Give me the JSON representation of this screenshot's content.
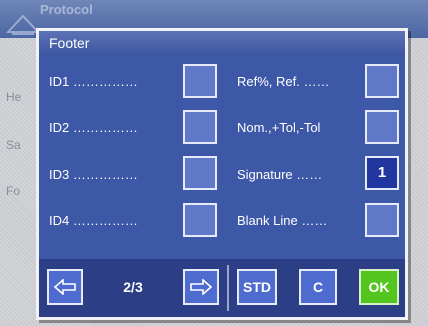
{
  "background": {
    "title": "Protocol",
    "right_fragment": "",
    "items": [
      "He",
      "Sa",
      "Fo"
    ]
  },
  "dialog": {
    "title": "Footer",
    "left_column": [
      {
        "label": "ID1 ……………",
        "checked": false,
        "value": ""
      },
      {
        "label": "ID2 ……………",
        "checked": false,
        "value": ""
      },
      {
        "label": "ID3 ……………",
        "checked": false,
        "value": ""
      },
      {
        "label": "ID4 ……………",
        "checked": false,
        "value": ""
      }
    ],
    "right_column": [
      {
        "label": "Ref%, Ref. ……",
        "checked": false,
        "value": ""
      },
      {
        "label": "Nom.,+Tol,-Tol",
        "checked": false,
        "value": ""
      },
      {
        "label": "Signature ……",
        "checked": true,
        "value": "1"
      },
      {
        "label": "Blank Line ……",
        "checked": false,
        "value": ""
      }
    ],
    "pager": "2/3",
    "buttons": {
      "std": "STD",
      "c": "C",
      "ok": "OK"
    }
  },
  "icons": {
    "prev": "arrow-left-icon",
    "next": "arrow-right-icon"
  },
  "colors": {
    "title_bar": "#4c63ad",
    "body": "#3e58a8",
    "bar": "#2c3f86",
    "ok": "#52c51e",
    "checked": "#2236a0"
  }
}
